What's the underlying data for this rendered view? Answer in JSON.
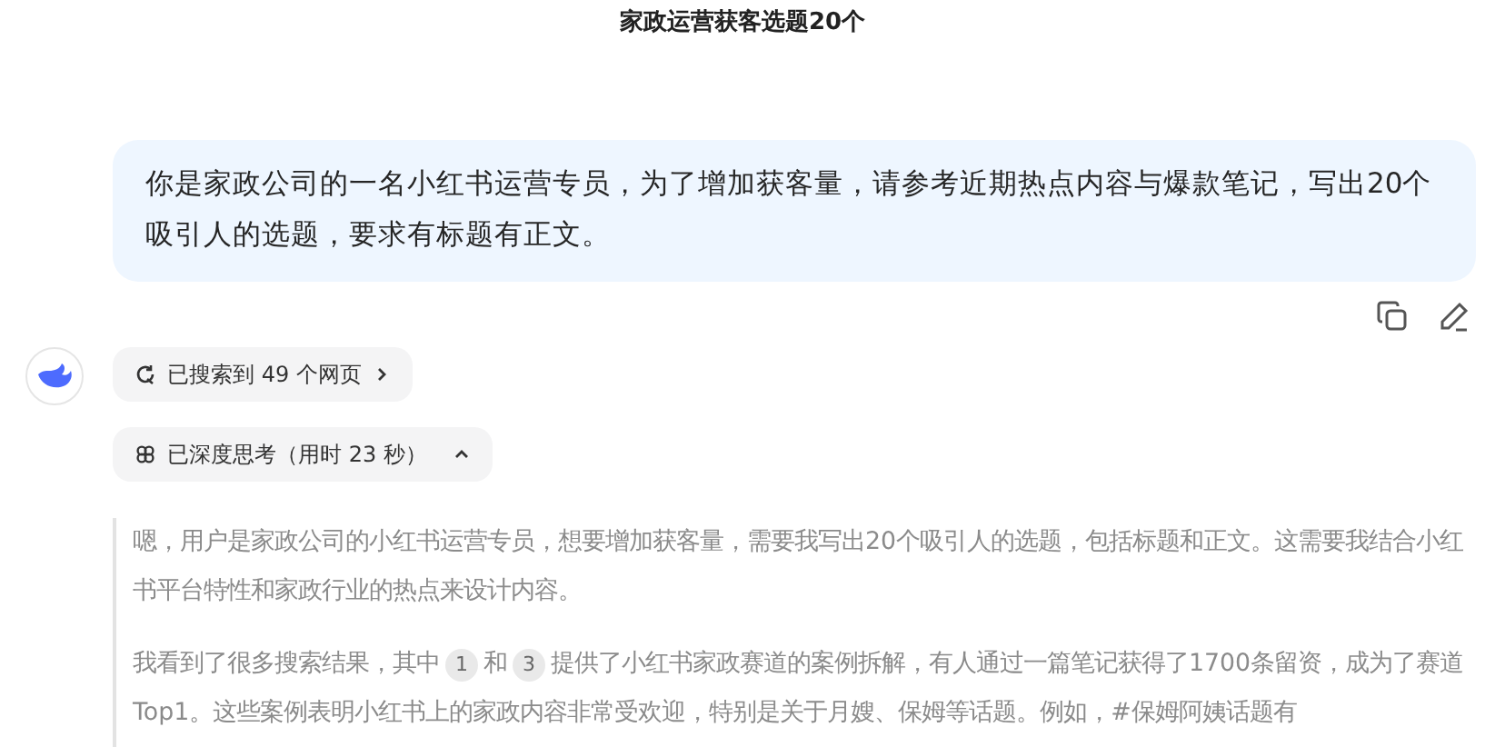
{
  "title": "家政运营获客选题20个",
  "user_message": {
    "text": "你是家政公司的一名小红书运营专员，为了增加获客量，请参考近期热点内容与爆款笔记，写出20个吸引人的选题，要求有标题有正文。"
  },
  "search_chip": {
    "label": "已搜索到 49 个网页"
  },
  "thinking_chip": {
    "label": "已深度思考（用时 23 秒）",
    "expanded": true
  },
  "thinking": [
    [
      {
        "kind": "text",
        "text": "嗯，用户是家政公司的小红书运营专员，想要增加获客量，需要我写出20个吸引人的选题，包括标题和正文。这需要我结合小红书平台特性和家政行业的热点来设计内容。"
      }
    ],
    [
      {
        "kind": "text",
        "text": "我看到了很多搜索结果，其中"
      },
      {
        "kind": "cite",
        "text": "1"
      },
      {
        "kind": "text",
        "text": "和"
      },
      {
        "kind": "cite",
        "text": "3"
      },
      {
        "kind": "text",
        "text": "提供了小红书家政赛道的案例拆解，有人通过一篇笔记获得了1700条留资，成为了赛道Top1。这些案例表明小红书上的家政内容非常受欢迎，特别是关于月嫂、保姆等话题。例如，#保姆阿姨话题有"
      }
    ]
  ]
}
